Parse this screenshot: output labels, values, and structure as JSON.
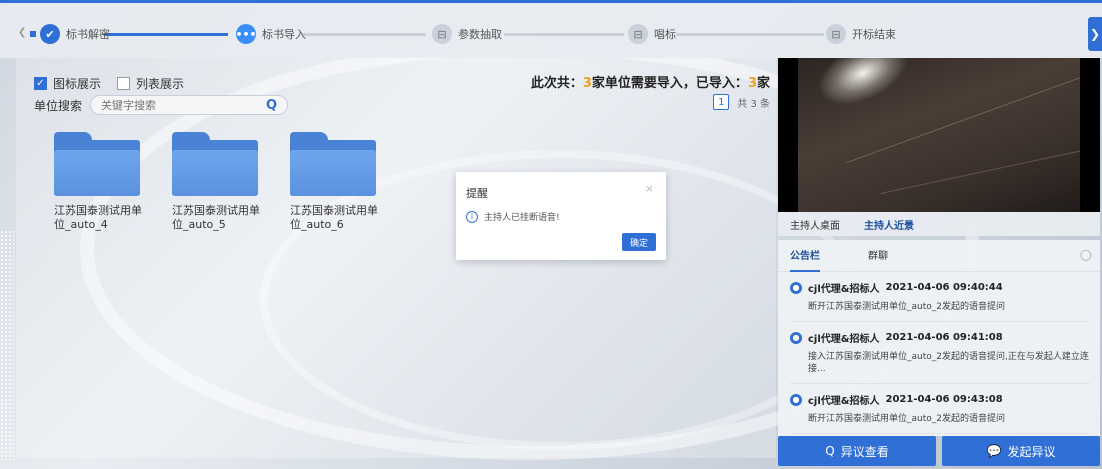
{
  "stepper": {
    "steps": [
      {
        "label": "标书解密",
        "state": "done",
        "glyph": "✔"
      },
      {
        "label": "标书导入",
        "state": "active",
        "glyph": "•••"
      },
      {
        "label": "参数抽取",
        "state": "todo",
        "glyph": "⊟"
      },
      {
        "label": "唱标",
        "state": "todo",
        "glyph": "⊟"
      },
      {
        "label": "开标结束",
        "state": "todo",
        "glyph": "⊟"
      }
    ],
    "expand_glyph": "❯"
  },
  "left": {
    "view_icon": "图标展示",
    "view_list": "列表展示",
    "search_label": "单位搜索",
    "search_placeholder": "关键字搜索",
    "summary_prefix": "此次共：",
    "summary_total": "3",
    "summary_mid": "家单位需要导入，已导入：",
    "summary_imported": "3",
    "summary_suffix": "家",
    "page_current": "1",
    "page_total": "共 3 条",
    "folders": [
      {
        "label": "江苏国泰测试用单位_auto_4"
      },
      {
        "label": "江苏国泰测试用单位_auto_5"
      },
      {
        "label": "江苏国泰测试用单位_auto_6"
      }
    ]
  },
  "dialog": {
    "title": "提醒",
    "message": "主持人已挂断语音!",
    "ok": "确定",
    "close": "×"
  },
  "video": {
    "tab_desktop": "主持人桌面",
    "tab_closeup": "主持人近景"
  },
  "board": {
    "tab_notice": "公告栏",
    "tab_chat": "群聊",
    "messages": [
      {
        "sender": "cjl代理&招标人",
        "time": "2021-04-06 09:40:44",
        "body": "断开江苏国泰测试用单位_auto_2发起的语音提问"
      },
      {
        "sender": "cjl代理&招标人",
        "time": "2021-04-06 09:41:08",
        "body": "接入江苏国泰测试用单位_auto_2发起的语音提问,正在与发起人建立连接..."
      },
      {
        "sender": "cjl代理&招标人",
        "time": "2021-04-06 09:43:08",
        "body": "断开江苏国泰测试用单位_auto_2发起的语音提问"
      }
    ]
  },
  "actions": {
    "view_objection": "异议查看",
    "raise_objection": "发起异议"
  },
  "colors": {
    "accent": "#2f6fd6",
    "highlight": "#e9a21f"
  }
}
